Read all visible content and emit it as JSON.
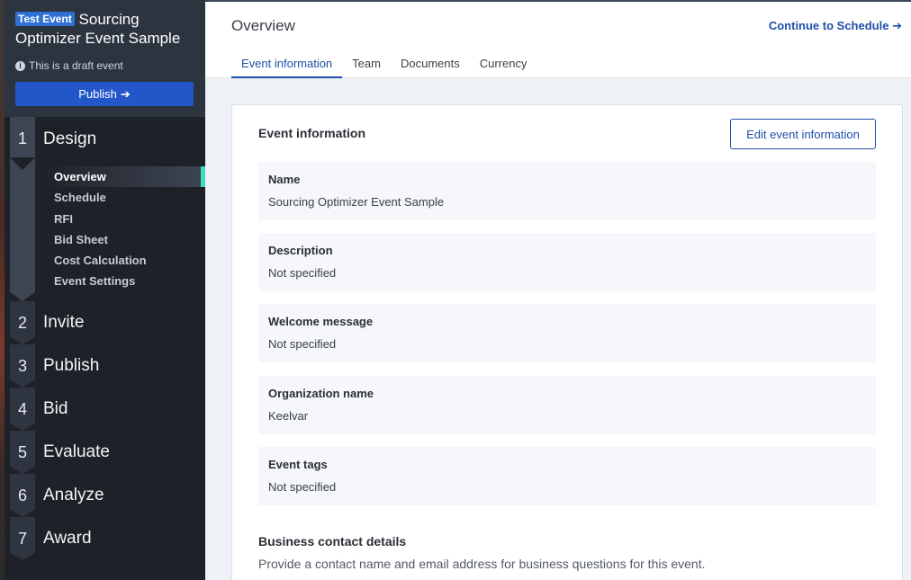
{
  "sidebar": {
    "badge": "Test Event",
    "event_title_line1": "Sourcing",
    "event_title_line2": "Optimizer Event Sample",
    "draft_text": "This is a draft event",
    "publish_label": "Publish",
    "steps": [
      {
        "num": "1",
        "label": "Design"
      },
      {
        "num": "2",
        "label": "Invite"
      },
      {
        "num": "3",
        "label": "Publish"
      },
      {
        "num": "4",
        "label": "Bid"
      },
      {
        "num": "5",
        "label": "Evaluate"
      },
      {
        "num": "6",
        "label": "Analyze"
      },
      {
        "num": "7",
        "label": "Award"
      }
    ],
    "design_substeps": [
      "Overview",
      "Schedule",
      "RFI",
      "Bid Sheet",
      "Cost Calculation",
      "Event Settings"
    ],
    "active_substep": "Overview"
  },
  "header": {
    "title": "Overview",
    "continue_label": "Continue to Schedule",
    "tabs": [
      "Event information",
      "Team",
      "Documents",
      "Currency"
    ],
    "active_tab": "Event information"
  },
  "card": {
    "title": "Event information",
    "edit_label": "Edit event information",
    "fields": [
      {
        "label": "Name",
        "value": "Sourcing Optimizer Event Sample"
      },
      {
        "label": "Description",
        "value": "Not specified"
      },
      {
        "label": "Welcome message",
        "value": "Not specified"
      },
      {
        "label": "Organization name",
        "value": "Keelvar"
      },
      {
        "label": "Event tags",
        "value": "Not specified"
      }
    ],
    "business_title": "Business contact details",
    "business_desc": "Provide a contact name and email address for business questions for this event."
  },
  "colors": {
    "accent": "#1e4fa8",
    "publish_button": "#2356c8",
    "active_marker": "#3fd9c0",
    "sidebar_bg": "#1f2129"
  }
}
